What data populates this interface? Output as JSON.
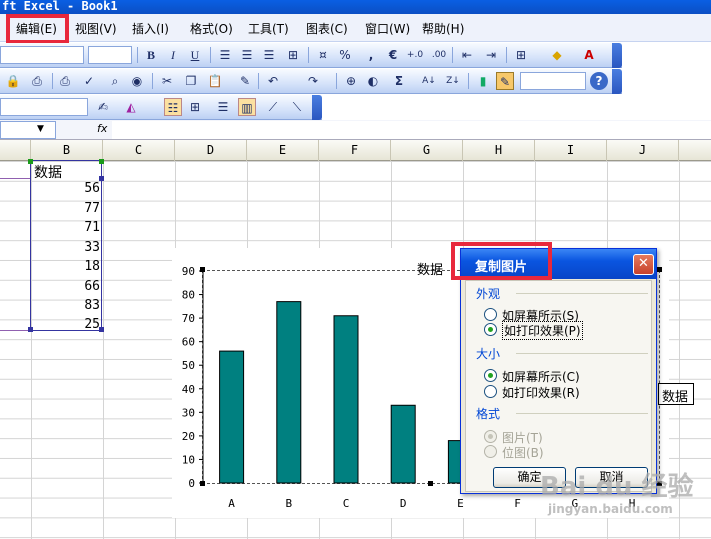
{
  "window": {
    "title": "ft Excel - Book1"
  },
  "menu": {
    "items": [
      "编辑(E)",
      "视图(V)",
      "插入(I)",
      "格式(O)",
      "工具(T)",
      "图表(C)",
      "窗口(W)",
      "帮助(H)"
    ]
  },
  "toolbar": {
    "bold": "B",
    "italic": "I",
    "underline": "U",
    "percent": "%",
    "comma": ",",
    "euro": "€",
    "sum": "Σ",
    "zoom_help": "?",
    "font_color": "A"
  },
  "formula_bar": {
    "fx": "fx"
  },
  "sheet": {
    "columns": [
      "B",
      "C",
      "D",
      "E",
      "F",
      "G",
      "H",
      "I",
      "J"
    ],
    "cells": {
      "header": "数据",
      "values": [
        "56",
        "77",
        "71",
        "33",
        "18",
        "66",
        "83",
        "25"
      ]
    }
  },
  "chart_data": {
    "type": "bar",
    "title": "数据",
    "categories": [
      "A",
      "B",
      "C",
      "D",
      "E",
      "F",
      "G",
      "H"
    ],
    "series": [
      {
        "name": "数据",
        "values": [
          56,
          77,
          71,
          33,
          18,
          66,
          83,
          25
        ]
      }
    ],
    "ylim": [
      0,
      90
    ],
    "yticks": [
      "0",
      "10",
      "20",
      "30",
      "40",
      "50",
      "60",
      "70",
      "80",
      "90"
    ],
    "bar_color": "#008080",
    "legend": "right"
  },
  "dialog": {
    "title": "复制图片",
    "close": "✕",
    "appearance": {
      "label": "外观",
      "options": [
        {
          "label": "如屏幕所示(S)",
          "checked": false
        },
        {
          "label": "如打印效果(P)",
          "checked": true
        }
      ]
    },
    "size": {
      "label": "大小",
      "options": [
        {
          "label": "如屏幕所示(C)",
          "checked": true
        },
        {
          "label": "如打印效果(R)",
          "checked": false
        }
      ]
    },
    "format": {
      "label": "格式",
      "options": [
        {
          "label": "图片(T)",
          "checked": true
        },
        {
          "label": "位图(B)",
          "checked": false
        }
      ]
    },
    "ok": "确定",
    "cancel": "取消"
  },
  "watermark": {
    "text": "Bai du 经验",
    "sub": "jingyan.baidu.com"
  },
  "colors": {
    "accent": "#e8283c",
    "title_blue": "#0a55e0",
    "bar": "#008080"
  }
}
